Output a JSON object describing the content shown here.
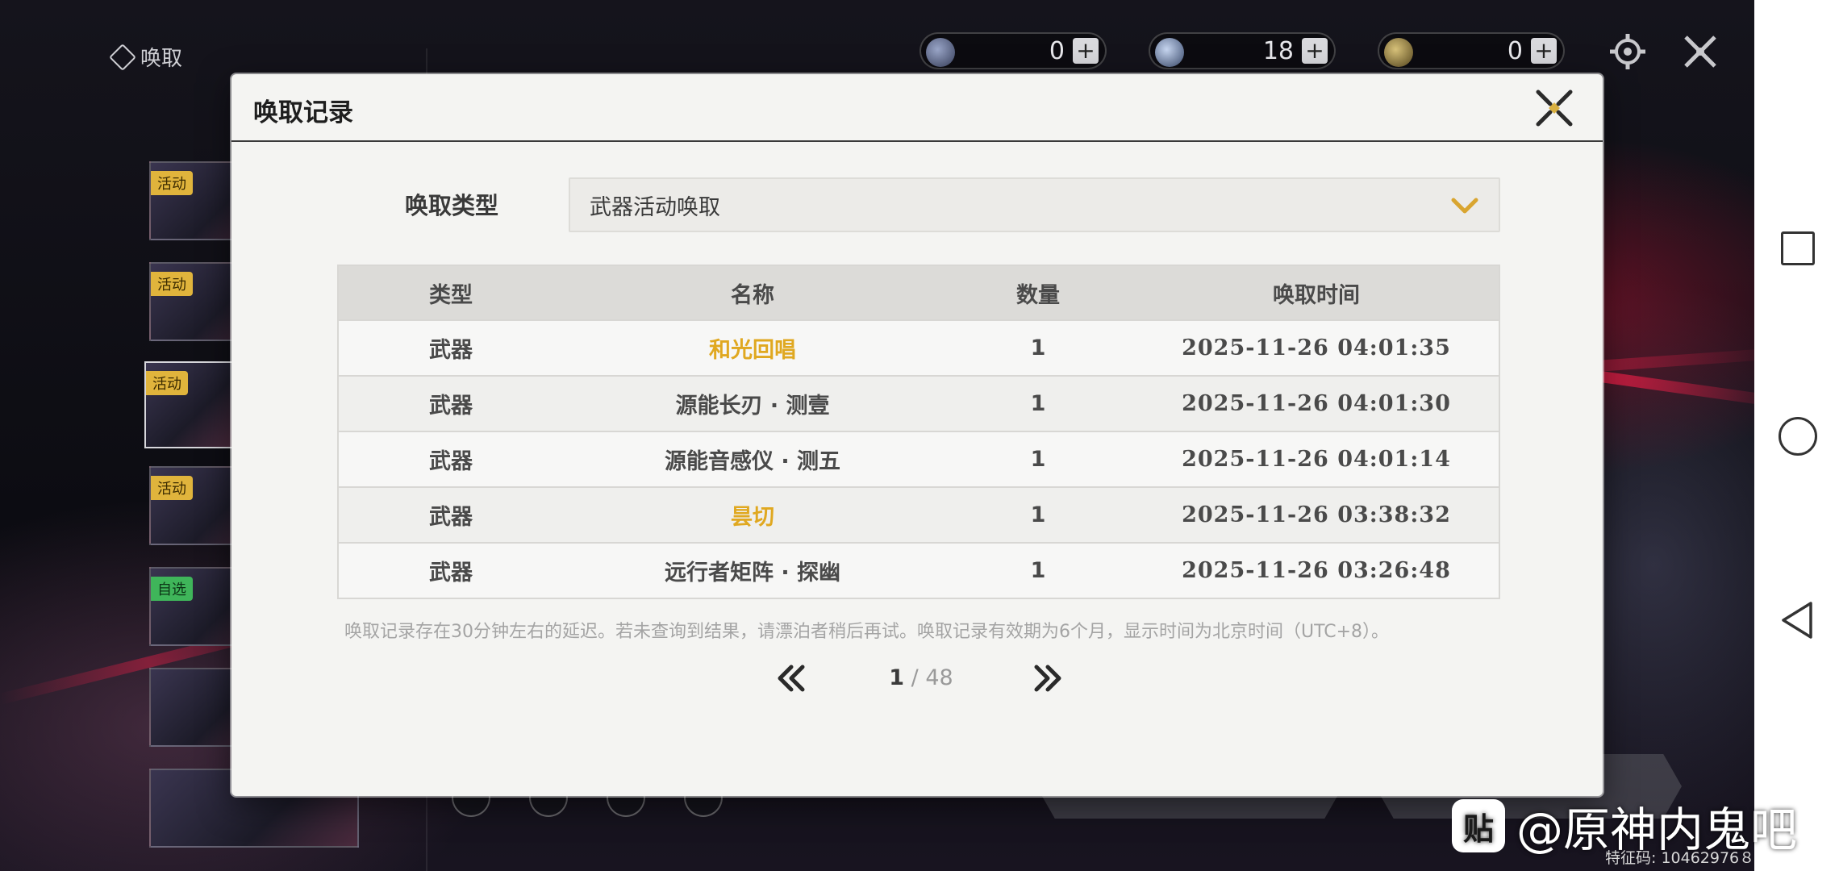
{
  "nav": {
    "title": "唤取"
  },
  "currencies": [
    {
      "value": "0",
      "icon": "lustrous-tide-icon"
    },
    {
      "value": "18",
      "icon": "radiant-tide-icon"
    },
    {
      "value": "0",
      "icon": "forging-tide-icon"
    }
  ],
  "banners": [
    {
      "tag": "活动"
    },
    {
      "tag": "活动"
    },
    {
      "tag": "活动"
    },
    {
      "tag": "活动"
    },
    {
      "tag": "自选"
    }
  ],
  "dialog": {
    "title": "唤取记录",
    "type_label": "唤取类型",
    "type_selected": "武器活动唤取",
    "columns": [
      "类型",
      "名称",
      "数量",
      "唤取时间"
    ],
    "rows": [
      {
        "type": "武器",
        "name": "和光回唱",
        "count": "1",
        "time": "2025-11-26 04:01:35",
        "highlight": true
      },
      {
        "type": "武器",
        "name": "源能长刃 · 测壹",
        "count": "1",
        "time": "2025-11-26 04:01:30",
        "highlight": false
      },
      {
        "type": "武器",
        "name": "源能音感仪 · 测五",
        "count": "1",
        "time": "2025-11-26 04:01:14",
        "highlight": false
      },
      {
        "type": "武器",
        "name": "昙切",
        "count": "1",
        "time": "2025-11-26 03:38:32",
        "highlight": true
      },
      {
        "type": "武器",
        "name": "远行者矩阵 · 探幽",
        "count": "1",
        "time": "2025-11-26 03:26:48",
        "highlight": false
      }
    ],
    "notice": "唤取记录存在30分钟左右的延迟。若未查询到结果，请漂泊者稍后再试。唤取记录有效期为6个月，显示时间为北京时间（UTC+8）。",
    "pager": {
      "current": "1",
      "separator": " / ",
      "total": "48"
    }
  },
  "watermark": {
    "logo": "贴",
    "text": "@原神内鬼吧",
    "code": "特征码: 10462976８"
  },
  "colors": {
    "highlight": "#e0a820",
    "dialog_bg": "#f4f4f2",
    "header_bg": "#dcdbd8"
  }
}
